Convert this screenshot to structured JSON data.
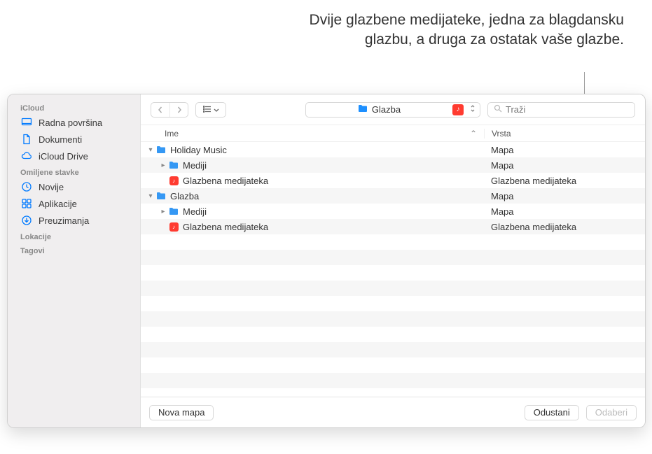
{
  "annotation": "Dvije glazbene medijateke, jedna za blagdansku glazbu, a druga za ostatak vaše glazbe.",
  "sidebar": {
    "sections": [
      {
        "header": "iCloud",
        "items": [
          {
            "label": "Radna površina",
            "icon": "desktop"
          },
          {
            "label": "Dokumenti",
            "icon": "doc"
          },
          {
            "label": "iCloud Drive",
            "icon": "cloud"
          }
        ]
      },
      {
        "header": "Omiljene stavke",
        "items": [
          {
            "label": "Novije",
            "icon": "clock"
          },
          {
            "label": "Aplikacije",
            "icon": "apps"
          },
          {
            "label": "Preuzimanja",
            "icon": "download"
          }
        ]
      },
      {
        "header": "Lokacije",
        "items": []
      },
      {
        "header": "Tagovi",
        "items": []
      }
    ]
  },
  "toolbar": {
    "path_label": "Glazba",
    "search_placeholder": "Traži"
  },
  "columns": {
    "name": "Ime",
    "kind": "Vrsta"
  },
  "rows": [
    {
      "depth": 0,
      "disclosure": "open",
      "icon": "folder",
      "name": "Holiday Music",
      "kind": "Mapa"
    },
    {
      "depth": 1,
      "disclosure": "closed",
      "icon": "folder",
      "name": "Mediji",
      "kind": "Mapa"
    },
    {
      "depth": 1,
      "disclosure": "none",
      "icon": "library",
      "name": "Glazbena medijateka",
      "kind": "Glazbena medijateka"
    },
    {
      "depth": 0,
      "disclosure": "open",
      "icon": "folder",
      "name": "Glazba",
      "kind": "Mapa"
    },
    {
      "depth": 1,
      "disclosure": "closed",
      "icon": "folder",
      "name": "Mediji",
      "kind": "Mapa"
    },
    {
      "depth": 1,
      "disclosure": "none",
      "icon": "library",
      "name": "Glazbena medijateka",
      "kind": "Glazbena medijateka"
    }
  ],
  "footer": {
    "new_folder": "Nova mapa",
    "cancel": "Odustani",
    "choose": "Odaberi"
  }
}
